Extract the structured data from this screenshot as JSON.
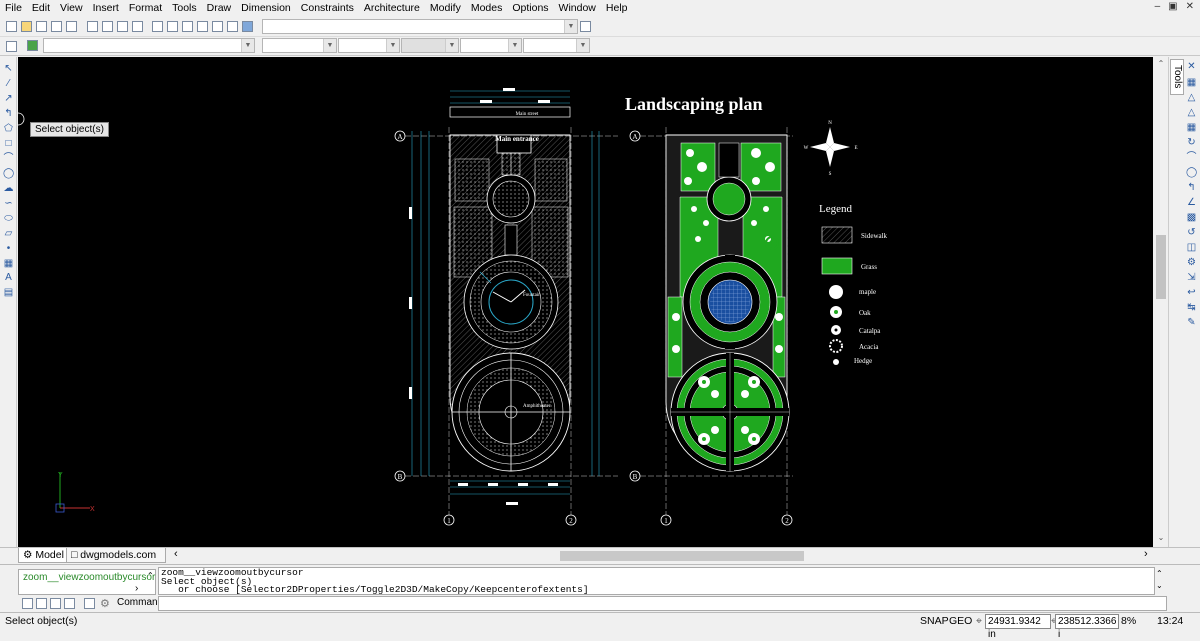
{
  "menu": [
    "File",
    "Edit",
    "View",
    "Insert",
    "Format",
    "Tools",
    "Draw",
    "Dimension",
    "Constraints",
    "Architecture",
    "Modify",
    "Modes",
    "Options",
    "Window",
    "Help"
  ],
  "canvas": {
    "title": "Landscaping plan",
    "tooltip": "Select object(s)",
    "left_plan": {
      "top_labels": [
        "Main street",
        "Main entrance"
      ],
      "fountain_label": "Fountain",
      "amphitheater_label": "Amphitheater",
      "grid_markers": [
        "A",
        "B",
        "1",
        "2"
      ]
    },
    "compass": {
      "n": "N",
      "e": "E",
      "s": "S",
      "w": "W"
    },
    "legend": {
      "title": "Legend",
      "items": [
        {
          "label": "Sidewalk"
        },
        {
          "label": "Grass"
        },
        {
          "label": "maple"
        },
        {
          "label": "Oak"
        },
        {
          "label": "Catalpa"
        },
        {
          "label": "Acacia"
        },
        {
          "label": "Hedge"
        }
      ]
    },
    "colors": {
      "grass": "#1fa81f",
      "lines": "#ffffff",
      "dims": "#2aa7c8",
      "fountain": "#1a4fa0"
    }
  },
  "right_panel": {
    "tab": "Tools"
  },
  "layout_tabs": {
    "model": "Model",
    "file": "dwgmodels.com"
  },
  "command": {
    "recent": "zoom__viewzoomoutbycursor",
    "history": [
      "zoom__viewzoomoutbycursor",
      "Select object(s)",
      "   or choose [Selector2DProperties/Toggle2D3D/MakeCopy/Keepcenterofextents]"
    ],
    "prompt_label": "Command:",
    "value": ""
  },
  "status": {
    "message": "Select object(s)",
    "snap": "SNAP",
    "geo": "GEO",
    "coord_x": "24931.9342 in",
    "coord_y": "238512.3366 i",
    "zoom": "8%",
    "time": "13:24"
  }
}
